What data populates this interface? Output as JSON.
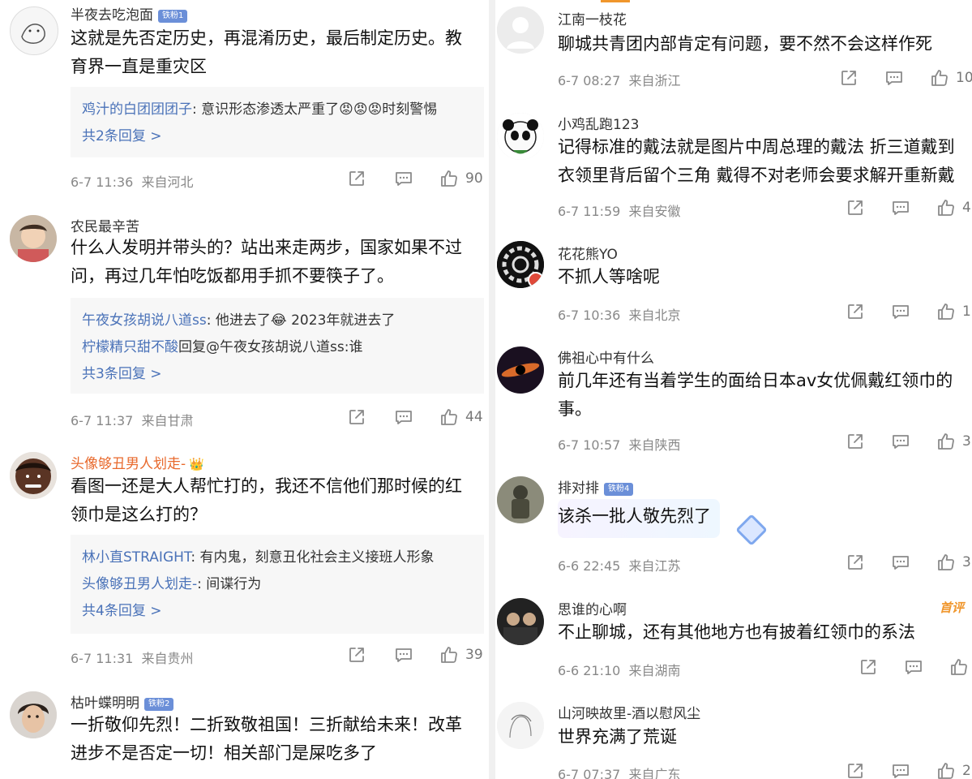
{
  "left": [
    {
      "name": "半夜去吃泡面",
      "badge": "铁粉1",
      "text": [
        "这就是先否定历史，再混淆历史，最后制定历史。教",
        "育界一直是重灾区"
      ],
      "replies": [
        {
          "user": "鸡汁的白团团团子",
          "content": ": 意识形态渗透太严重了😡😡😡时刻警惕"
        }
      ],
      "more": "共2条回复 >",
      "time": "6-7 11:36",
      "location": "来自河北",
      "likes": "90"
    },
    {
      "name": "农民最辛苦",
      "badge": "",
      "text": [
        "什么人发明并带头的？站出来走两步，国家如果不过",
        "问，再过几年怕吃饭都用手抓不要筷子了。"
      ],
      "replies": [
        {
          "user": "午夜女孩胡说八道ss",
          "content": ": 他进去了😂 2023年就进去了"
        },
        {
          "user": "柠檬精只甜不酸",
          "content": "回复@午夜女孩胡说八道ss:谁"
        }
      ],
      "more": "共3条回复 >",
      "time": "6-7 11:37",
      "location": "来自甘肃",
      "likes": "44"
    },
    {
      "name": "头像够丑男人划走-",
      "badge": "",
      "text": [
        "看图一还是大人帮忙打的，我还不信他们那时候的红",
        "领巾是这么打的？"
      ],
      "replies": [
        {
          "user": "林小直STRAIGHT",
          "content": ": 有内鬼，刻意丑化社会主义接班人形象"
        },
        {
          "user": "头像够丑男人划走-",
          "content": ": 间谍行为"
        }
      ],
      "more": "共4条回复 >",
      "time": "6-7 11:31",
      "location": "来自贵州",
      "likes": "39"
    },
    {
      "name": "枯叶蝶明明",
      "badge": "铁粉2",
      "text": [
        "一折敬仰先烈！二折致敬祖国！三折献给未来！改革",
        "进步不是否定一切！相关部门是屎吃多了"
      ]
    }
  ],
  "right": [
    {
      "name": "江南一枝花",
      "badge": "",
      "text": [
        "聊城共青团内部肯定有问题，要不然不会这样作死"
      ],
      "time": "6-7 08:27",
      "location": "来自浙江",
      "likes": "10"
    },
    {
      "name": "小鸡乱跑123",
      "badge": "",
      "text": [
        "记得标准的戴法就是图片中周总理的戴法  折三道戴到",
        "衣领里背后留个三角  戴得不对老师会要求解开重新戴"
      ],
      "time": "6-7 11:59",
      "location": "来自安徽",
      "likes": "4"
    },
    {
      "name": "花花熊YO",
      "badge": "",
      "text": [
        "不抓人等啥呢"
      ],
      "time": "6-7 10:36",
      "location": "来自北京",
      "likes": "1"
    },
    {
      "name": "佛祖心中有什么",
      "badge": "",
      "text": [
        "前几年还有当着学生的面给日本av女优佩戴红领巾的",
        "事。"
      ],
      "time": "6-7 10:57",
      "location": "来自陕西",
      "likes": "3"
    },
    {
      "name": "排对排",
      "badge": "铁粉4",
      "text": [
        "该杀一批人敬先烈了"
      ],
      "time": "6-6 22:45",
      "location": "来自江苏",
      "likes": "3"
    },
    {
      "name": "思谁的心啊",
      "badge": "",
      "tag": "首评",
      "text": [
        "不止聊城，还有其他地方也有披着红领巾的系法"
      ],
      "time": "6-6 21:10",
      "location": "来自湖南",
      "likes": ""
    },
    {
      "name": "山河映故里-酒以慰风尘",
      "badge": "",
      "text": [
        "世界充满了荒诞"
      ],
      "time": "6-7 07:37",
      "location": "来自广东",
      "likes": "2"
    }
  ]
}
